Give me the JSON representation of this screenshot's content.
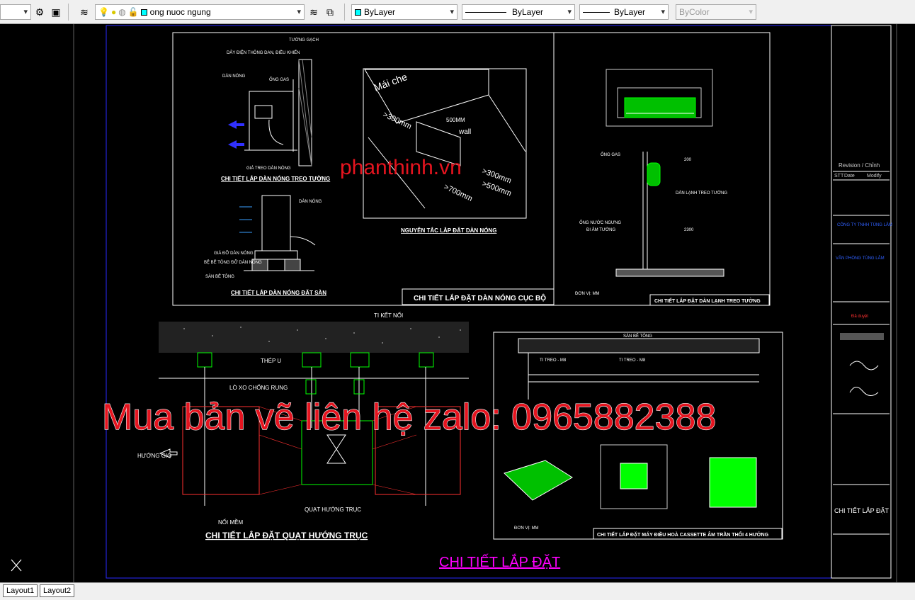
{
  "toolbar": {
    "layer_name": "ong nuoc ngung",
    "color": "ByLayer",
    "linetype": "ByLayer",
    "lineweight": "ByLayer",
    "plotstyle": "ByColor"
  },
  "tabs": [
    "Layout1",
    "Layout2"
  ],
  "drawing": {
    "title_wall_outdoor": "CHI TIẾT LẮP DÀN NÓNG TREO TƯỜNG",
    "title_floor_outdoor": "CHI TIẾT LẮP DÀN NÓNG ĐẶT SÀN",
    "title_principle": "NGUYÊN TẮC LẮP ĐẶT DÀN NÓNG",
    "title_local": "CHI TIẾT LẮP ĐẶT DÀN NÓNG CỤC BỘ",
    "title_indoor": "CHI TIẾT LẮP ĐẶT DÀN LẠNH TREO TƯỜNG",
    "title_fan": "CHI TIẾT LẮP ĐẶT QUẠT HƯỚNG TRỤC",
    "title_cassette": "CHI TIẾT LẮP ĐẶT MÁY ĐIỀU HOÀ CASSETTE ÂM TRẦN THỔI 4 HƯỚNG",
    "main_title": "CHI TIẾT LẮP ĐẶT",
    "watermark_site": "phanthinh.vn",
    "watermark_contact": "Mua bản vẽ liên hệ zalo: 0965882388",
    "labels": {
      "tuong_gach": "TƯỜNG GẠCH",
      "day_dien": "DÂY ĐIỆN THÔNG DAN, ĐIỀU KHIỂN",
      "dan_nong": "DÀN NÓNG",
      "ong_gas": "ỐNG GAS",
      "gia_treo": "GIÁ TREO DÀN NÓNG",
      "gia_do": "GIÁ ĐỠ DÀN NÓNG",
      "be_tong": "BỆ BÊ TÔNG ĐỠ DÀN NÓNG",
      "san_be_tong": "SÀN BÊ TÔNG",
      "mai_che": "Mái che",
      "d500": "500MM",
      "wall": "wall",
      "d300a": ">300mm",
      "d300b": ">300mm",
      "d500b": ">500mm",
      "d700": ">700mm",
      "ong_gas2": "ỐNG GAS",
      "dim200": "200",
      "dan_lanh": "DÀN LẠNH TREO TƯỜNG",
      "ong_nuoc": "ỐNG NƯỚC NGƯNG",
      "di_am_tuong": "ĐI ÂM TƯỜNG",
      "dim2300": "2300",
      "don_vi": "ĐƠN VỊ: MM",
      "ti_ket_noi": "TI KẾT NỐI",
      "thep_u": "THÉP U",
      "lo_xo": "LÒ XO CHỐNG RUNG",
      "huong_gio": "HƯỚNG GIÓ",
      "quat_huong_truc": "QUẠT HƯỚNG TRỤC",
      "noi_mem": "NỐI MỀM",
      "san_be_tong2": "SÀN BÊ TÔNG",
      "ti_treo": "TI TREO - M8",
      "ti_treo2": "TI TREO - M8",
      "don_vi2": "ĐƠN VỊ: MM"
    }
  },
  "titleblock": {
    "revision": "Revision / Chỉnh",
    "stt": "STT",
    "date": "Date",
    "modify": "Modify",
    "company": "CÔNG TY TNHH TÙNG LÂM",
    "project": "VĂN PHÒNG TÙNG LÂM",
    "approved": "Đã duyệt",
    "sheet_title": "CHI TIẾT LẮP ĐẶT"
  },
  "colors": {
    "accent_red": "#e5141f",
    "cad_green": "#00ff00",
    "cad_magenta": "#ff00ff",
    "cad_blue": "#3030ff"
  }
}
